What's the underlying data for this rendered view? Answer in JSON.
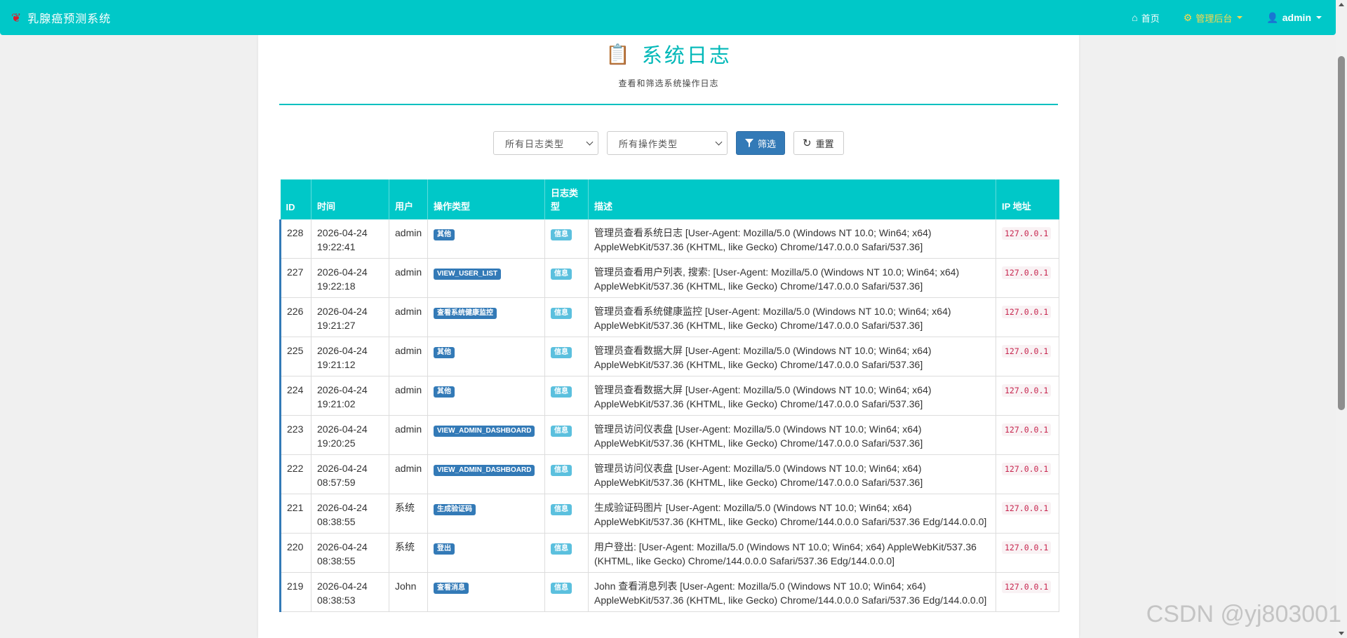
{
  "navbar": {
    "brand": "乳腺癌预测系统",
    "home": "首页",
    "admin_panel": "管理后台",
    "user": "admin"
  },
  "page": {
    "title": "系统日志",
    "subtitle": "查看和筛选系统操作日志"
  },
  "filters": {
    "log_type_selected": "所有日志类型",
    "action_type_selected": "所有操作类型",
    "filter_button": "筛选",
    "reset_button": "重置"
  },
  "table": {
    "headers": {
      "id": "ID",
      "time": "时间",
      "user": "用户",
      "action": "操作类型",
      "log_type": "日志类型",
      "desc": "描述",
      "ip": "IP 地址"
    },
    "rows": [
      {
        "id": "228",
        "date": "2026-04-24",
        "clock": "19:22:41",
        "user": "admin",
        "action": "其他",
        "log_type": "信息",
        "desc": "管理员查看系统日志 [User-Agent: Mozilla/5.0 (Windows NT 10.0; Win64; x64) AppleWebKit/537.36 (KHTML, like Gecko) Chrome/147.0.0.0 Safari/537.36]",
        "ip": "127.0.0.1"
      },
      {
        "id": "227",
        "date": "2026-04-24",
        "clock": "19:22:18",
        "user": "admin",
        "action": "VIEW_USER_LIST",
        "log_type": "信息",
        "desc": "管理员查看用户列表, 搜索:  [User-Agent: Mozilla/5.0 (Windows NT 10.0; Win64; x64) AppleWebKit/537.36 (KHTML, like Gecko) Chrome/147.0.0.0 Safari/537.36]",
        "ip": "127.0.0.1"
      },
      {
        "id": "226",
        "date": "2026-04-24",
        "clock": "19:21:27",
        "user": "admin",
        "action": "查看系统健康监控",
        "log_type": "信息",
        "desc": "管理员查看系统健康监控 [User-Agent: Mozilla/5.0 (Windows NT 10.0; Win64; x64) AppleWebKit/537.36 (KHTML, like Gecko) Chrome/147.0.0.0 Safari/537.36]",
        "ip": "127.0.0.1"
      },
      {
        "id": "225",
        "date": "2026-04-24",
        "clock": "19:21:12",
        "user": "admin",
        "action": "其他",
        "log_type": "信息",
        "desc": "管理员查看数据大屏 [User-Agent: Mozilla/5.0 (Windows NT 10.0; Win64; x64) AppleWebKit/537.36 (KHTML, like Gecko) Chrome/147.0.0.0 Safari/537.36]",
        "ip": "127.0.0.1"
      },
      {
        "id": "224",
        "date": "2026-04-24",
        "clock": "19:21:02",
        "user": "admin",
        "action": "其他",
        "log_type": "信息",
        "desc": "管理员查看数据大屏 [User-Agent: Mozilla/5.0 (Windows NT 10.0; Win64; x64) AppleWebKit/537.36 (KHTML, like Gecko) Chrome/147.0.0.0 Safari/537.36]",
        "ip": "127.0.0.1"
      },
      {
        "id": "223",
        "date": "2026-04-24",
        "clock": "19:20:25",
        "user": "admin",
        "action": "VIEW_ADMIN_DASHBOARD",
        "log_type": "信息",
        "desc": "管理员访问仪表盘 [User-Agent: Mozilla/5.0 (Windows NT 10.0; Win64; x64) AppleWebKit/537.36 (KHTML, like Gecko) Chrome/147.0.0.0 Safari/537.36]",
        "ip": "127.0.0.1"
      },
      {
        "id": "222",
        "date": "2026-04-24",
        "clock": "08:57:59",
        "user": "admin",
        "action": "VIEW_ADMIN_DASHBOARD",
        "log_type": "信息",
        "desc": "管理员访问仪表盘 [User-Agent: Mozilla/5.0 (Windows NT 10.0; Win64; x64) AppleWebKit/537.36 (KHTML, like Gecko) Chrome/147.0.0.0 Safari/537.36]",
        "ip": "127.0.0.1"
      },
      {
        "id": "221",
        "date": "2026-04-24",
        "clock": "08:38:55",
        "user": "系统",
        "action": "生成验证码",
        "log_type": "信息",
        "desc": "生成验证码图片 [User-Agent: Mozilla/5.0 (Windows NT 10.0; Win64; x64) AppleWebKit/537.36 (KHTML, like Gecko) Chrome/144.0.0.0 Safari/537.36 Edg/144.0.0.0]",
        "ip": "127.0.0.1"
      },
      {
        "id": "220",
        "date": "2026-04-24",
        "clock": "08:38:55",
        "user": "系统",
        "action": "登出",
        "log_type": "信息",
        "desc": "用户登出:  [User-Agent: Mozilla/5.0 (Windows NT 10.0; Win64; x64) AppleWebKit/537.36 (KHTML, like Gecko) Chrome/144.0.0.0 Safari/537.36 Edg/144.0.0.0]",
        "ip": "127.0.0.1"
      },
      {
        "id": "219",
        "date": "2026-04-24",
        "clock": "08:38:53",
        "user": "John",
        "action": "查看消息",
        "log_type": "信息",
        "desc": "John 查看消息列表 [User-Agent: Mozilla/5.0 (Windows NT 10.0; Win64; x64) AppleWebKit/537.36 (KHTML, like Gecko) Chrome/144.0.0.0 Safari/537.36 Edg/144.0.0.0]",
        "ip": "127.0.0.1"
      }
    ]
  },
  "watermark": "CSDN @yj803001",
  "icons": {
    "brand": "ribbon-icon",
    "home": "home-icon",
    "admin": "gear-icon",
    "user": "user-icon",
    "title": "clipboard-icon",
    "filter": "filter-icon",
    "reset": "refresh-icon"
  },
  "colors": {
    "navbar": "#00c8c8",
    "title": "#00b8b8",
    "primary": "#337ab7",
    "info": "#5bc0de",
    "ip_code": "#c7254e",
    "admin_panel": "#ffd84a"
  }
}
